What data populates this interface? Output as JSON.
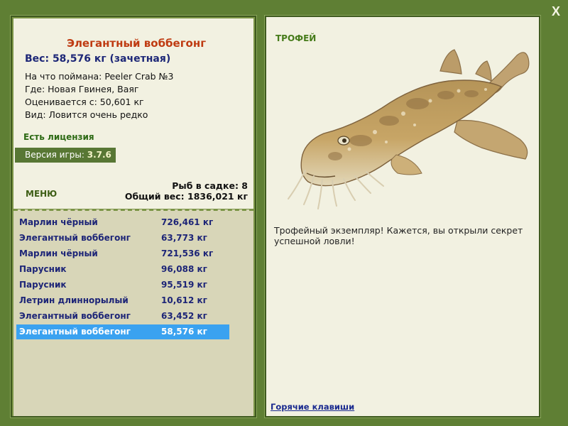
{
  "window": {
    "close_label": "X"
  },
  "catch_info": {
    "fish_name": "Элегантный воббегонг",
    "weight_line": "Вес: 58,576 кг (зачетная)",
    "bait_line": "На что поймана: Peeler Crab №3",
    "place_line": "Где: Новая Гвинея, Ваяг",
    "valued_line": "Оценивается с: 50,601 кг",
    "kind_line": "Вид: Ловится очень редко"
  },
  "license_label": "Есть лицензия",
  "version": {
    "label": "Версия игры:",
    "value": "3.7.6"
  },
  "menu_label": "МЕНЮ",
  "net": {
    "count_line": "Рыб в садке: 8",
    "total_line": "Общий вес: 1836,021 кг"
  },
  "catch_list": [
    {
      "name": "Марлин чёрный",
      "weight": "726,461 кг"
    },
    {
      "name": "Элегантный воббегонг",
      "weight": "63,773 кг"
    },
    {
      "name": "Марлин чёрный",
      "weight": "721,536 кг"
    },
    {
      "name": "Парусник",
      "weight": "96,088 кг"
    },
    {
      "name": "Парусник",
      "weight": "95,519 кг"
    },
    {
      "name": "Летрин длиннорылый",
      "weight": "10,612 кг"
    },
    {
      "name": "Элегантный воббегонг",
      "weight": "63,452 кг"
    },
    {
      "name": "Элегантный воббегонг",
      "weight": "58,576 кг"
    }
  ],
  "selected_index": 7,
  "trophy": {
    "label": "ТРОФЕЙ",
    "description": "Трофейный экземпляр! Кажется, вы открыли секрет успешной ловли!",
    "hotkeys_link": "Горячие клавиши"
  },
  "colors": {
    "frame": "#5f7f34",
    "panel_bg": "#f2f1e1",
    "list_bg": "#d8d6b8",
    "selection": "#3aa2f0",
    "fish_title": "#bf3b12",
    "list_text": "#1d2577"
  },
  "icons": {
    "close": "close-icon",
    "fish": "wobbegong-fish-image"
  }
}
